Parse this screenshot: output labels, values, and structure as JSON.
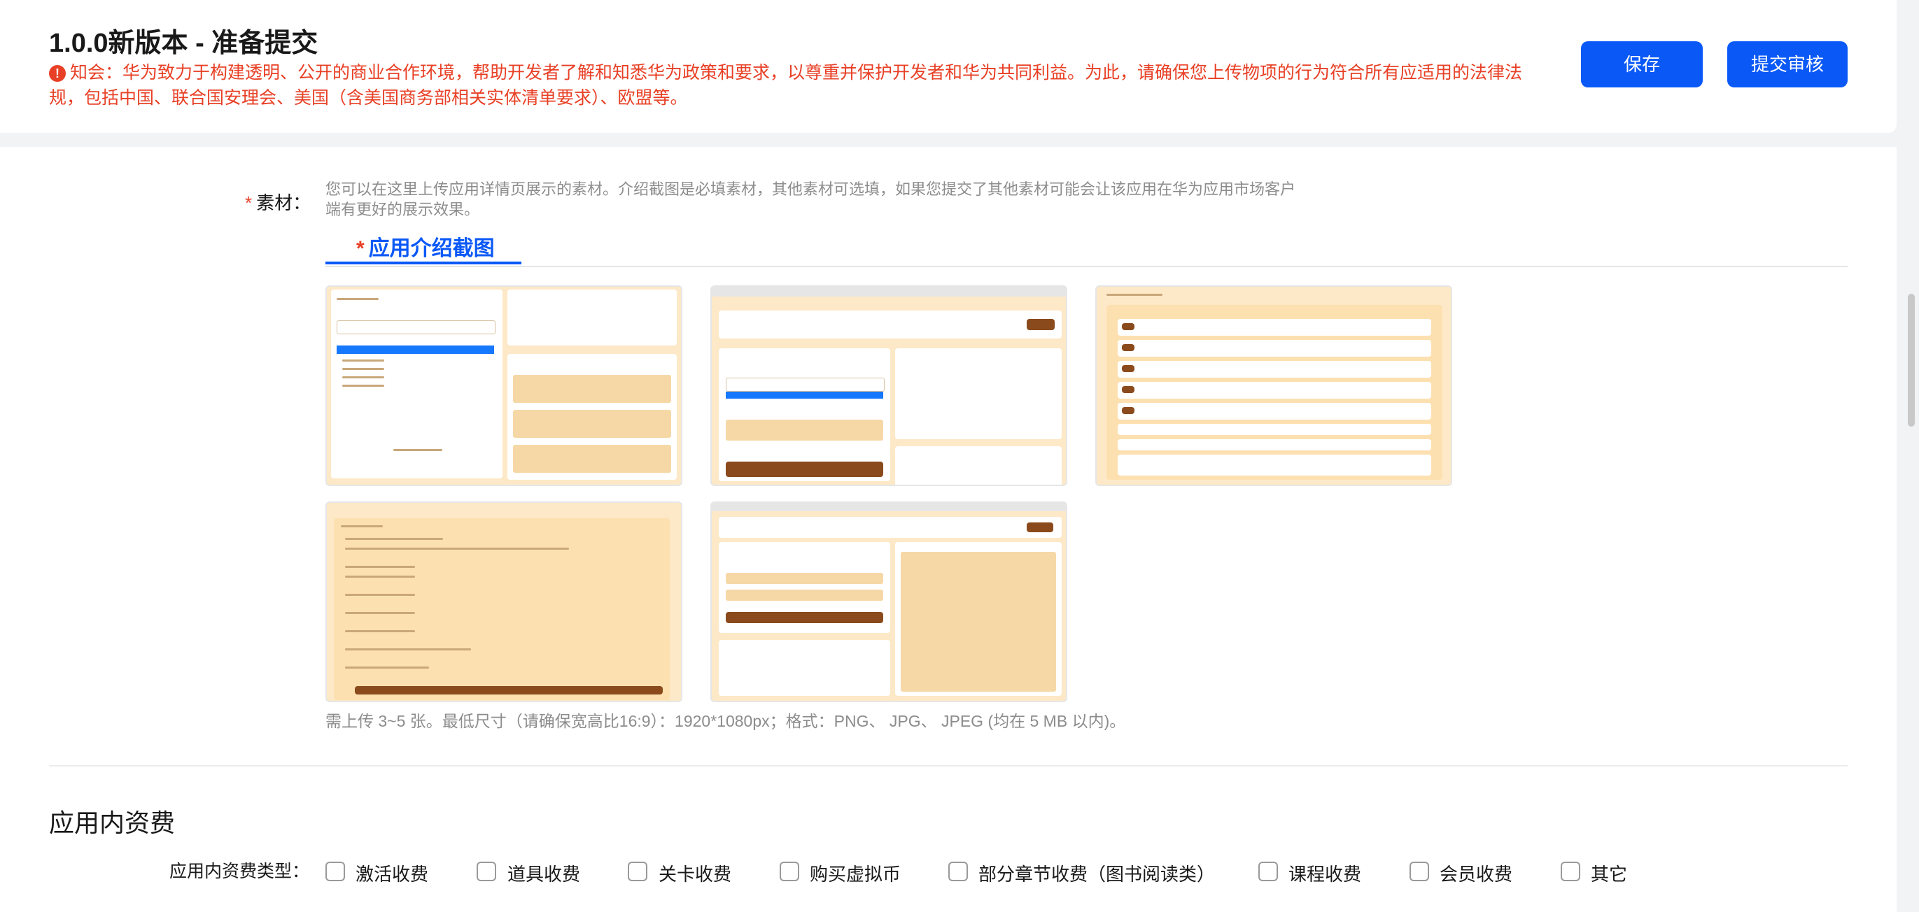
{
  "header": {
    "title": "1.0.0新版本 - 准备提交",
    "notice": "知会：华为致力于构建透明、公开的商业合作环境，帮助开发者了解和知悉华为政策和要求，以尊重并保护开发者和华为共同利益。为此，请确保您上传物项的行为符合所有应适用的法律法规，包括中国、联合国安理会、美国（含美国商务部相关实体清单要求）、欧盟等。",
    "notice_icon": "!",
    "save_label": "保存",
    "submit_label": "提交审核"
  },
  "material": {
    "required_mark": "*",
    "label": "素材：",
    "description": "您可以在这里上传应用详情页展示的素材。介绍截图是必填素材，其他素材可选填，如果您提交了其他素材可能会让该应用在华为应用市场客户端有更好的展示效果。",
    "tab_label": "应用介绍截图",
    "screenshots": [
      {
        "name": "screenshot-1"
      },
      {
        "name": "screenshot-2"
      },
      {
        "name": "screenshot-3"
      },
      {
        "name": "screenshot-4"
      },
      {
        "name": "screenshot-5"
      }
    ],
    "hint": "需上传 3~5 张。最低尺寸（请确保宽高比16:9）：1920*1080px；格式：PNG、 JPG、 JPEG (均在 5 MB 以内)。"
  },
  "in_app_fee": {
    "section_title": "应用内资费",
    "type_label": "应用内资费类型：",
    "options": [
      "激活收费",
      "道具收费",
      "关卡收费",
      "购买虚拟币",
      "部分章节收费（图书阅读类）",
      "课程收费",
      "会员收费",
      "其它"
    ]
  },
  "colors": {
    "primary": "#0a59f7",
    "warning": "#e84026",
    "thumbnail_bg": "#fde9c7",
    "thumbnail_accent": "#8a4a1c"
  }
}
